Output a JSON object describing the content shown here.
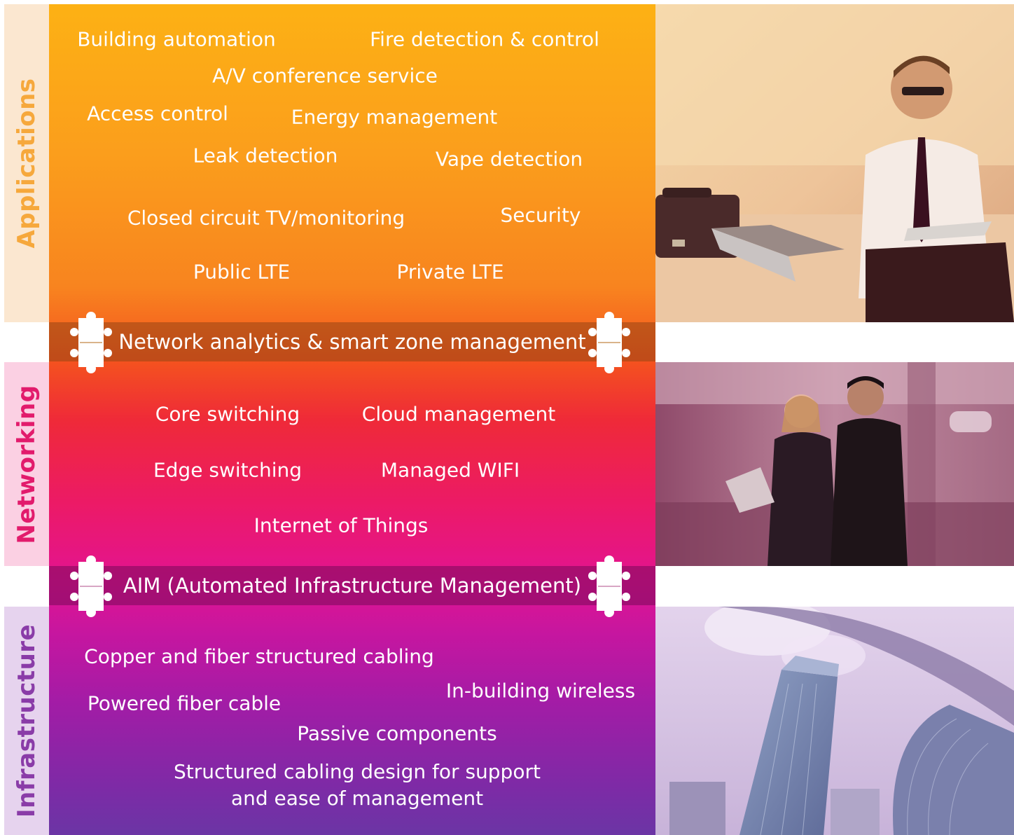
{
  "sections": {
    "applications": {
      "label": "Applications",
      "tint": "#f6a83c"
    },
    "networking": {
      "label": "Networking",
      "tint": "#e21b6c"
    },
    "infrastructure": {
      "label": "Infrastructure",
      "tint": "#8a3ca8"
    }
  },
  "applications_items": [
    "Building automation",
    "Fire detection & control",
    "A/V conference service",
    "Access control",
    "Energy management",
    "Leak detection",
    "Vape detection",
    "Closed circuit TV/monitoring",
    "Security",
    "Public LTE",
    "Private LTE"
  ],
  "bands": {
    "top": "Network analytics & smart zone management",
    "bottom": "AIM (Automated Infrastructure Management)"
  },
  "networking_items": [
    "Core switching",
    "Cloud management",
    "Edge switching",
    "Managed WIFI",
    "Internet of Things"
  ],
  "infrastructure_items": [
    "Copper and fiber structured cabling",
    "In-building wireless",
    "Powered fiber cable",
    "Passive components",
    "Structured cabling design for support and ease of management"
  ],
  "photos": [
    {
      "subject": "businessman-with-tablet-on-bed"
    },
    {
      "subject": "colleagues-walking-with-tablet"
    },
    {
      "subject": "skyscrapers-looking-up"
    }
  ],
  "colors": {
    "orange": "#fdb114",
    "red": "#ef2a38",
    "magenta": "#e3148f",
    "purple": "#6b35a5"
  }
}
